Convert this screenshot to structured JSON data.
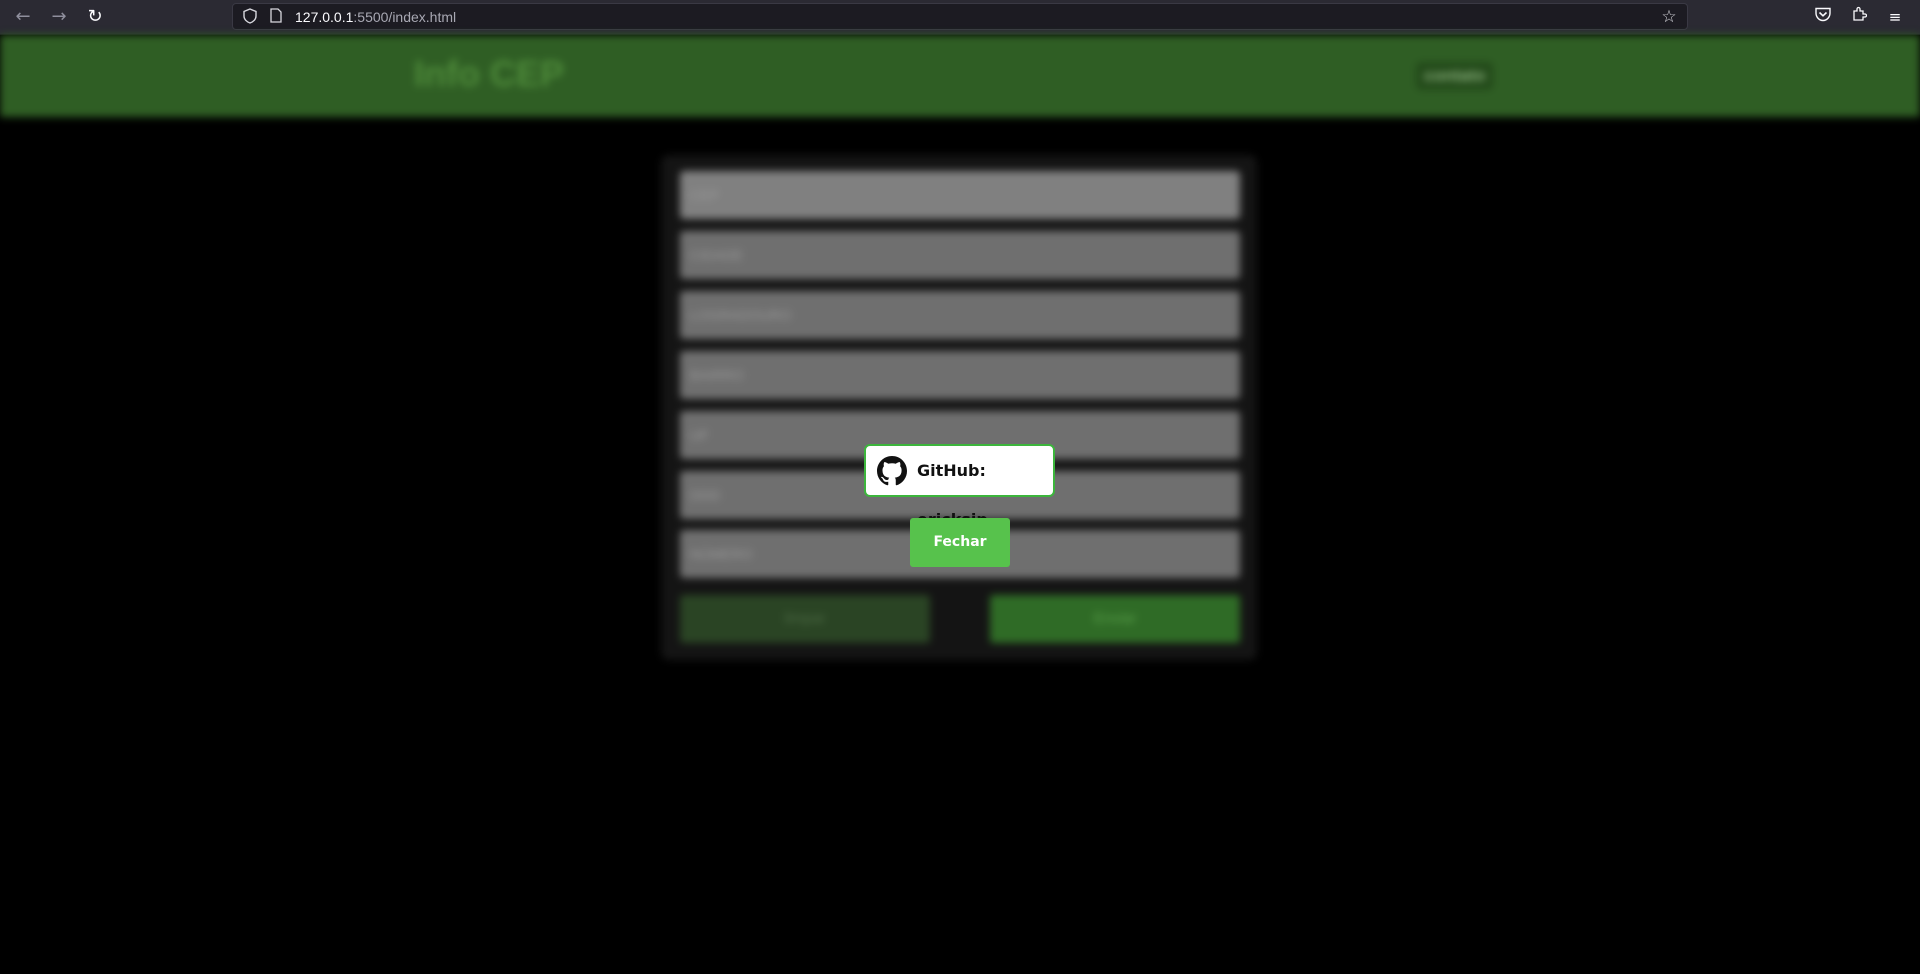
{
  "browser": {
    "url_host": "127.0.0.1",
    "url_path": ":5500/index.html",
    "icons": [
      "back-arrow-icon",
      "forward-arrow-icon",
      "reload-icon",
      "shield-icon",
      "page-icon",
      "star-icon",
      "pocket-icon",
      "extensions-icon",
      "menu-icon"
    ]
  },
  "header": {
    "logo": "Info CEP",
    "contact_label": "contato"
  },
  "form": {
    "fields": [
      {
        "placeholder": "CEP"
      },
      {
        "placeholder": "CIDADE"
      },
      {
        "placeholder": "LOGRADOURO"
      },
      {
        "placeholder": "BAIRRO"
      },
      {
        "placeholder": "UF"
      },
      {
        "placeholder": "DDD"
      },
      {
        "placeholder": "NÚMERO"
      }
    ],
    "clear_label": "limpar",
    "search_label": "Enviar"
  },
  "modal": {
    "github_label": "GitHub: ericksjp",
    "close_label": "Fechar"
  },
  "colors": {
    "header_green": "#2f5e24",
    "accent_green": "#57c24c",
    "modal_border": "#3cb53c"
  }
}
